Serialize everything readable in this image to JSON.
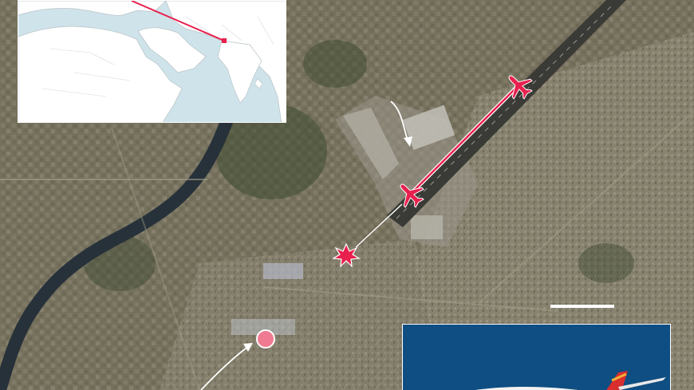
{
  "map": {
    "colors": {
      "ground": "#6b6753",
      "urban": "#8f8a77",
      "vegetation": "#3e4a30",
      "river": "#27313a",
      "runway": "#3a3a36",
      "airport_apron": "#a8a59a",
      "flight_path": "#e8204d",
      "crash_marker": "#e8204d",
      "site_marker": "#f07a91",
      "arrow": "#ffffff",
      "land_inset": "#ffffff",
      "sea_inset": "#cfe3ea",
      "photo_sky": "#0f4e82"
    },
    "icons": {
      "departure_plane": "airplane-icon",
      "crash_plane": "airplane-icon",
      "crash_site": "explosion-icon",
      "location_dot": "circle-marker-icon",
      "inset_origin": "square-marker-icon"
    }
  }
}
